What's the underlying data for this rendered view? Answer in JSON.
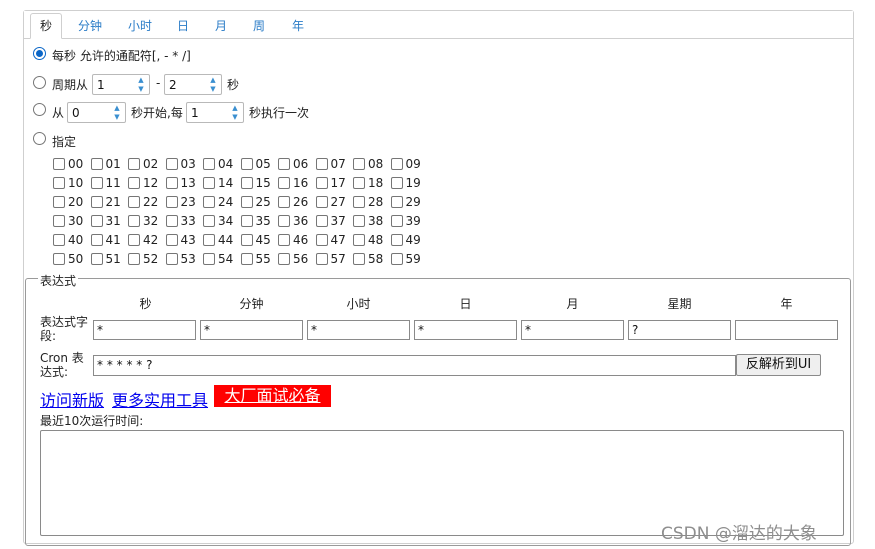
{
  "tabs": [
    "秒",
    "分钟",
    "小时",
    "日",
    "月",
    "周",
    "年"
  ],
  "options": {
    "every": "每秒 允许的通配符[, - * /]",
    "cycle_prefix": "周期从",
    "cycle_from": "1",
    "cycle_dash": "-",
    "cycle_to": "2",
    "cycle_unit": "秒",
    "from_prefix": "从",
    "from_start": "0",
    "from_mid": "秒开始,每",
    "from_step": "1",
    "from_suffix": "秒执行一次",
    "specify": "指定"
  },
  "seconds": [
    "00",
    "01",
    "02",
    "03",
    "04",
    "05",
    "06",
    "07",
    "08",
    "09",
    "10",
    "11",
    "12",
    "13",
    "14",
    "15",
    "16",
    "17",
    "18",
    "19",
    "20",
    "21",
    "22",
    "23",
    "24",
    "25",
    "26",
    "27",
    "28",
    "29",
    "30",
    "31",
    "32",
    "33",
    "34",
    "35",
    "36",
    "37",
    "38",
    "39",
    "40",
    "41",
    "42",
    "43",
    "44",
    "45",
    "46",
    "47",
    "48",
    "49",
    "50",
    "51",
    "52",
    "53",
    "54",
    "55",
    "56",
    "57",
    "58",
    "59"
  ],
  "expression": {
    "legend": "表达式",
    "headers": [
      "秒",
      "分钟",
      "小时",
      "日",
      "月",
      "星期",
      "年"
    ],
    "field_label": "表达式字段:",
    "values": [
      "*",
      "*",
      "*",
      "*",
      "*",
      "?",
      ""
    ],
    "cron_label": "Cron 表达式:",
    "cron_value": "* * * * * ?",
    "parse_button": "反解析到UI",
    "link_new": "访问新版",
    "link_tools": "更多实用工具",
    "promo": "大厂面试必备",
    "recent_label": "最近10次运行时间:"
  },
  "watermark": "CSDN @溜达的大象"
}
